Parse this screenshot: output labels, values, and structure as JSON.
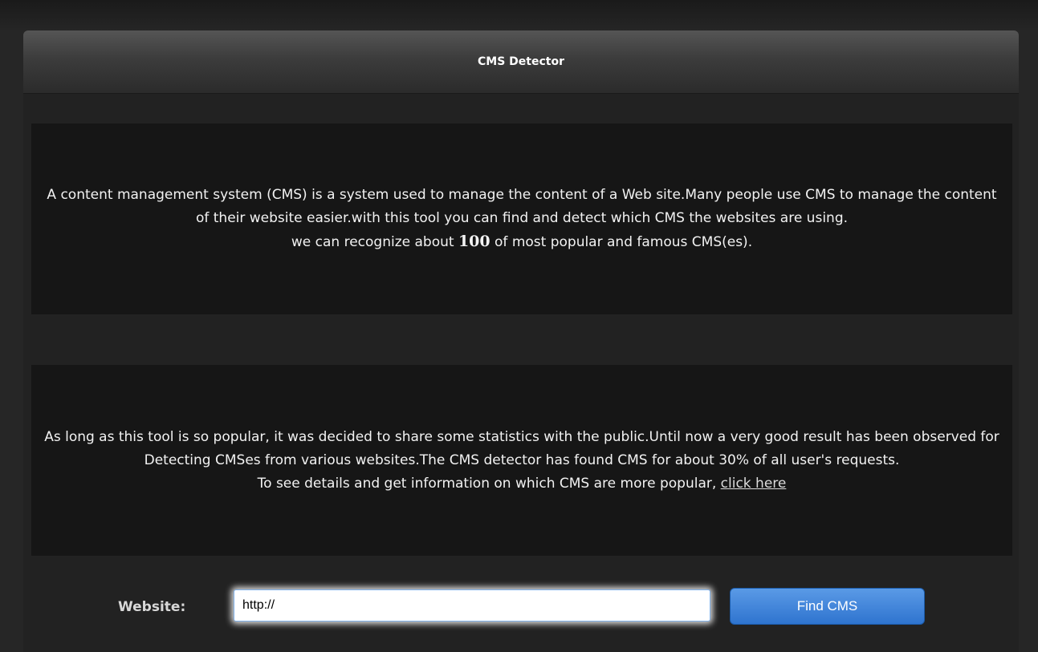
{
  "panel": {
    "title": "CMS Detector"
  },
  "about": {
    "line1": "A content management system (CMS) is a system used to manage the content of a Web site.Many people use CMS to manage the content of their website easier.with this tool you can find and detect which CMS the websites are using.",
    "line2_prefix": "we can recognize about ",
    "line2_number": "100",
    "line2_suffix": " of most popular and famous CMS(es)."
  },
  "stats": {
    "paragraph": "As long as this tool is so popular, it was decided to share some statistics with the public.Until now a very good result has been observed for Detecting CMSes from various websites.The CMS detector has found CMS for about 30% of all user's requests.",
    "details_prefix": "To see details and get information on which CMS are more popular, ",
    "details_link": "click here"
  },
  "form": {
    "website_label": "Website:",
    "url_value": "http://",
    "submit_label": "Find CMS"
  },
  "colors": {
    "button_accent": "#3a80d8",
    "panel_bg": "#222222",
    "box_bg": "#161616"
  }
}
